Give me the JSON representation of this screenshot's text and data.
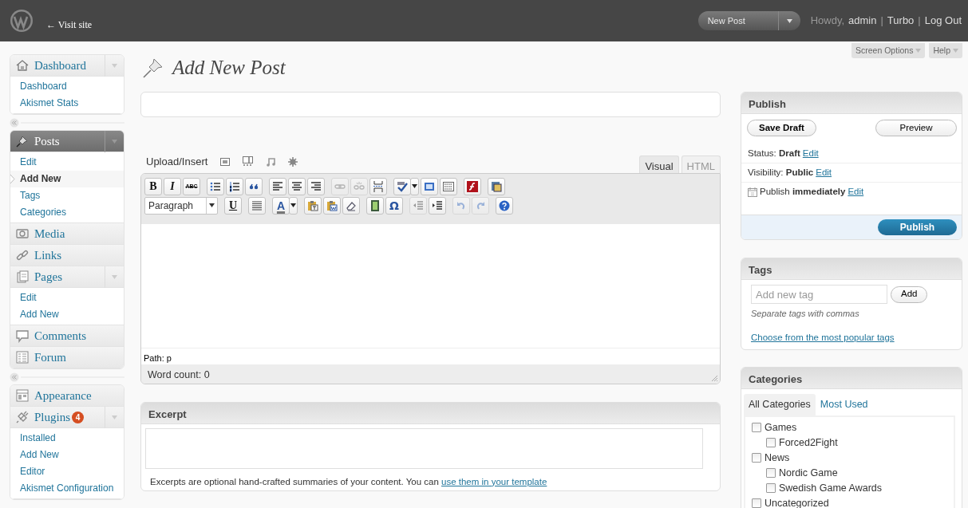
{
  "header": {
    "site_link": "← Visit site",
    "action_menu": {
      "label": "New Post"
    },
    "user_bar": [
      {
        "kind": "text",
        "text": "Howdy,"
      },
      {
        "kind": "link",
        "text": "admin"
      },
      {
        "kind": "text",
        "text": "|"
      },
      {
        "kind": "link",
        "text": "Turbo"
      },
      {
        "kind": "text",
        "text": "|"
      },
      {
        "kind": "link",
        "text": "Log Out"
      }
    ]
  },
  "screen_tabs": [
    "Screen Options",
    "Help"
  ],
  "sidebar": {
    "groups": [
      [
        {
          "kind": "dashboard",
          "label": "Dashboard",
          "current": false,
          "expanded": true,
          "children": [
            {
              "label": "Dashboard",
              "selected": false
            },
            {
              "label": "Akismet Stats",
              "selected": false
            }
          ]
        }
      ],
      [
        {
          "kind": "posts",
          "label": "Posts",
          "current": true,
          "expanded": true,
          "children": [
            {
              "label": "Edit",
              "selected": false
            },
            {
              "label": "Add New",
              "selected": true
            },
            {
              "label": "Tags",
              "selected": false
            },
            {
              "label": "Categories",
              "selected": false
            }
          ]
        },
        {
          "kind": "media",
          "label": "Media",
          "current": false
        },
        {
          "kind": "links",
          "label": "Links",
          "current": false
        },
        {
          "kind": "pages",
          "label": "Pages",
          "current": false,
          "expanded": true,
          "children": [
            {
              "label": "Edit",
              "selected": false
            },
            {
              "label": "Add New",
              "selected": false
            }
          ]
        },
        {
          "kind": "comments",
          "label": "Comments",
          "current": false
        },
        {
          "kind": "forum",
          "label": "Forum",
          "current": false
        }
      ],
      [
        {
          "kind": "appearance",
          "label": "Appearance",
          "current": false
        },
        {
          "kind": "plugins",
          "label": "Plugins",
          "badge": "4",
          "current": false,
          "expanded": true,
          "children": [
            {
              "label": "Installed",
              "selected": false
            },
            {
              "label": "Add New",
              "selected": false
            },
            {
              "label": "Editor",
              "selected": false
            },
            {
              "label": "Akismet Configuration",
              "selected": false
            }
          ]
        }
      ]
    ]
  },
  "page_title": "Add New Post",
  "editor": {
    "upload_label": "Upload/Insert",
    "modes": [
      {
        "label": "Visual",
        "selected": true
      },
      {
        "label": "HTML",
        "selected": false
      }
    ],
    "toolbar_rows": [
      [
        [
          {
            "kind": "bold",
            "label": "B",
            "disabled": false
          },
          {
            "kind": "italic",
            "label": "I",
            "disabled": false
          },
          {
            "kind": "strike",
            "label": "ABC",
            "disabled": false
          }
        ],
        [
          {
            "kind": "bullet-list",
            "disabled": false
          },
          {
            "kind": "number-list",
            "disabled": false
          },
          {
            "kind": "quote",
            "disabled": false
          }
        ],
        [
          {
            "kind": "align-left",
            "disabled": false
          },
          {
            "kind": "align-center",
            "disabled": false
          },
          {
            "kind": "align-right",
            "disabled": false
          }
        ],
        [
          {
            "kind": "link",
            "disabled": true
          },
          {
            "kind": "unlink",
            "disabled": true
          },
          {
            "kind": "page-break",
            "disabled": false
          }
        ],
        [
          {
            "kind": "spellcheck",
            "dropdown": true,
            "disabled": false
          },
          {
            "kind": "fullscreen",
            "disabled": false
          },
          {
            "kind": "toolbar-toggle",
            "disabled": false
          }
        ],
        [
          {
            "kind": "flash",
            "disabled": false
          }
        ],
        [
          {
            "kind": "window",
            "disabled": false
          }
        ]
      ],
      [
        [
          {
            "kind": "format-select",
            "label": "Paragraph",
            "disabled": false
          }
        ],
        [
          {
            "kind": "underline",
            "label": "U",
            "disabled": false
          }
        ],
        [
          {
            "kind": "justify",
            "disabled": false
          }
        ],
        [
          {
            "kind": "text-color",
            "label": "A",
            "dropdown": true,
            "disabled": false
          }
        ],
        [
          {
            "kind": "paste-text",
            "disabled": false
          },
          {
            "kind": "paste-word",
            "disabled": false
          },
          {
            "kind": "eraser",
            "disabled": false
          }
        ],
        [
          {
            "kind": "media",
            "disabled": false
          },
          {
            "kind": "special-char",
            "label": "Ω",
            "disabled": false
          }
        ],
        [
          {
            "kind": "outdent",
            "disabled": true
          },
          {
            "kind": "indent",
            "disabled": false
          }
        ],
        [
          {
            "kind": "undo",
            "disabled": true
          },
          {
            "kind": "redo",
            "disabled": true
          }
        ],
        [
          {
            "kind": "help",
            "disabled": false
          }
        ]
      ]
    ],
    "path": "Path: p",
    "word_count": "Word count: 0"
  },
  "excerpt": {
    "title": "Excerpt",
    "hint": "Excerpts are optional hand-crafted summaries of your content. You can ",
    "hint_link": "use them in your template"
  },
  "publish": {
    "title": "Publish",
    "save_button": "Save Draft",
    "preview_button": "Preview",
    "rows": [
      {
        "kind": "status",
        "label": "Status:",
        "value": "Draft",
        "link": "Edit"
      },
      {
        "kind": "visibility",
        "label": "Visibility:",
        "value": "Public",
        "link": "Edit"
      },
      {
        "kind": "schedule",
        "label": "Publish",
        "value": "immediately",
        "link": "Edit"
      }
    ],
    "publish_button": "Publish"
  },
  "tags": {
    "title": "Tags",
    "placeholder": "Add new tag",
    "add_button": "Add",
    "hint": "Separate tags with commas",
    "popular_link": "Choose from the most popular tags"
  },
  "categories": {
    "title": "Categories",
    "tabs": [
      {
        "label": "All Categories",
        "selected": true
      },
      {
        "label": "Most Used",
        "selected": false
      }
    ],
    "items": [
      {
        "label": "Games",
        "checked": false,
        "children": [
          {
            "label": "Forced2Fight",
            "checked": false
          }
        ]
      },
      {
        "label": "News",
        "checked": false,
        "children": [
          {
            "label": "Nordic Game",
            "checked": false
          },
          {
            "label": "Swedish Game Awards",
            "checked": false
          }
        ]
      },
      {
        "label": "Uncategorized",
        "checked": false
      }
    ]
  }
}
